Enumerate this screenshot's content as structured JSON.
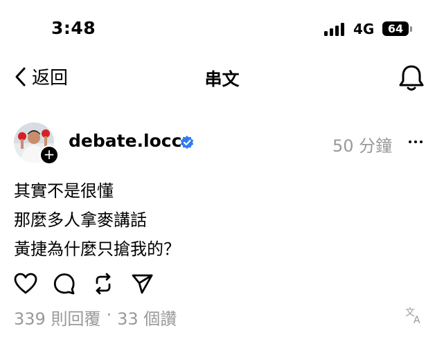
{
  "status_bar": {
    "time": "3:48",
    "network": "4G",
    "battery": "64"
  },
  "nav": {
    "back_label": "返回",
    "title": "串文",
    "notification_icon": "bell-icon"
  },
  "post": {
    "username": "debate.locc",
    "verified_color": "#2F7BF6",
    "time_ago": "50 分鐘",
    "lines": [
      "其實不是很懂",
      "那麼多人拿麥講話",
      "黃捷為什麼只搶我的？"
    ],
    "actions": [
      "heart-icon",
      "comment-icon",
      "repost-icon",
      "share-icon"
    ],
    "replies": "339 則回覆",
    "separator": "·",
    "likes": "33 個讚"
  }
}
